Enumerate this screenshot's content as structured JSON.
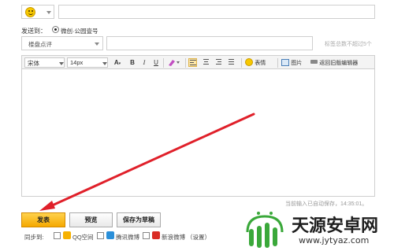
{
  "header": {
    "title_value": ""
  },
  "sendto": {
    "label": "发送到：",
    "option_label": "微创·公园壹号"
  },
  "category": {
    "selected": "楼盘点评"
  },
  "tags": {
    "value": "",
    "hint": "标签总数不超过5个"
  },
  "toolbar": {
    "font_family": "宋体",
    "font_size": "14px",
    "font_color_label": "A",
    "bold": "B",
    "italic": "I",
    "underline": "U",
    "emoji_label": "表情",
    "image_label": "图片",
    "old_editor_label": "返回旧版编辑器"
  },
  "editor": {
    "content": ""
  },
  "status": {
    "autosave_text": "当前输入已自动保存，14:35:01。"
  },
  "actions": {
    "publish": "发表",
    "preview": "预览",
    "save_draft": "保存为草稿"
  },
  "sync": {
    "label": "同步到:",
    "targets": [
      {
        "label": "QQ空间",
        "color": "#f6b100"
      },
      {
        "label": "腾讯微博",
        "color": "#2a8fd9"
      },
      {
        "label": "新浪微博",
        "color": "#d92c25"
      }
    ],
    "settings_label": "（设置）"
  },
  "watermark": {
    "title": "天源安卓网",
    "url": "www.jytyaz.com"
  },
  "colors": {
    "primary_button": "#f5a800",
    "arrow": "#e0202a",
    "watermark_green": "#3aa83a"
  }
}
